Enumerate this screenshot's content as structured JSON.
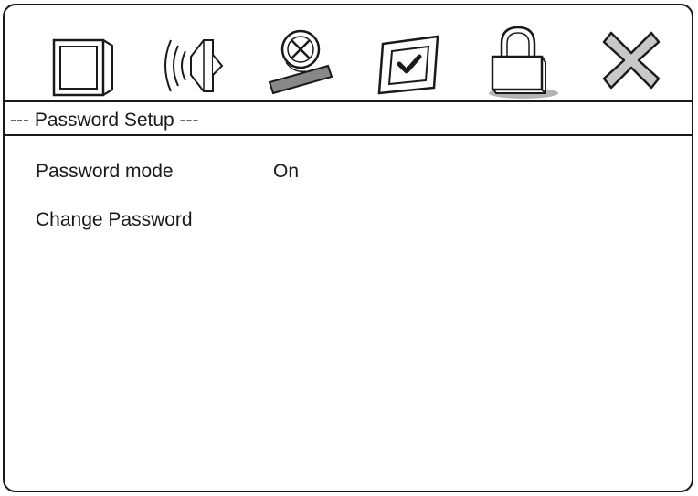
{
  "menu": {
    "tabs": [
      {
        "id": "video",
        "icon": "tv-icon"
      },
      {
        "id": "audio",
        "icon": "speaker-icon"
      },
      {
        "id": "language",
        "icon": "disc-no-icon"
      },
      {
        "id": "preferences",
        "icon": "checkbox-icon"
      },
      {
        "id": "password",
        "icon": "lock-icon",
        "selected": true
      },
      {
        "id": "exit",
        "icon": "close-x-icon"
      }
    ]
  },
  "section": {
    "title": "--- Password Setup ---"
  },
  "settings": [
    {
      "label": "Password mode",
      "value": "On"
    },
    {
      "label": "Change Password",
      "value": ""
    }
  ]
}
